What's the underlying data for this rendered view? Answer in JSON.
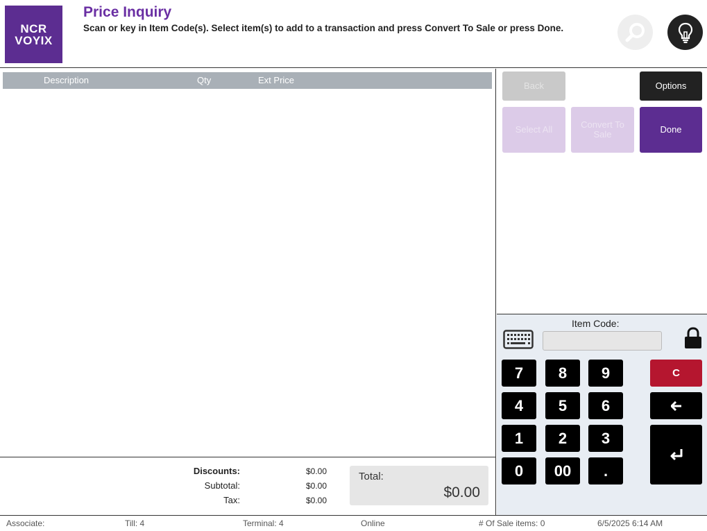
{
  "header": {
    "logo_line1": "NCR",
    "logo_line2": "VOYIX",
    "title": "Price Inquiry",
    "instructions": "Scan or key in Item Code(s). Select item(s) to add to a transaction and press Convert To Sale or press Done.",
    "search_icon": "search-icon",
    "hint_icon": "lightbulb-icon"
  },
  "list": {
    "columns": [
      "Description",
      "Qty",
      "Ext Price"
    ],
    "rows": []
  },
  "totals": {
    "discounts_label": "Discounts:",
    "discounts_value": "$0.00",
    "subtotal_label": "Subtotal:",
    "subtotal_value": "$0.00",
    "tax_label": "Tax:",
    "tax_value": "$0.00",
    "total_label": "Total:",
    "total_value": "$0.00"
  },
  "actions": {
    "back": "Back",
    "options": "Options",
    "select_all": "Select All",
    "convert_to_sale": "Convert To Sale",
    "done": "Done"
  },
  "keypad": {
    "item_code_label": "Item Code:",
    "item_code_value": "",
    "keys": [
      "7",
      "8",
      "9",
      "4",
      "5",
      "6",
      "1",
      "2",
      "3",
      "0",
      "00",
      "."
    ],
    "clear": "C",
    "keyboard_icon": "keyboard-icon",
    "lock_icon": "lock-icon",
    "backspace_icon": "backspace-arrow-icon",
    "enter_icon": "enter-icon"
  },
  "status": {
    "associate": "Associate:",
    "till": "Till: 4",
    "terminal": "Terminal: 4",
    "connection": "Online",
    "sale_items": "# Of Sale items: 0",
    "datetime": "6/5/2025 6:14 AM"
  },
  "colors": {
    "brand_purple": "#5c2d91",
    "title_purple": "#6a2fa3",
    "disabled_purple": "#dccbe8",
    "clear_red": "#b5162f",
    "header_gray": "#a9b0b7",
    "keypad_bg": "#e8edf3"
  }
}
